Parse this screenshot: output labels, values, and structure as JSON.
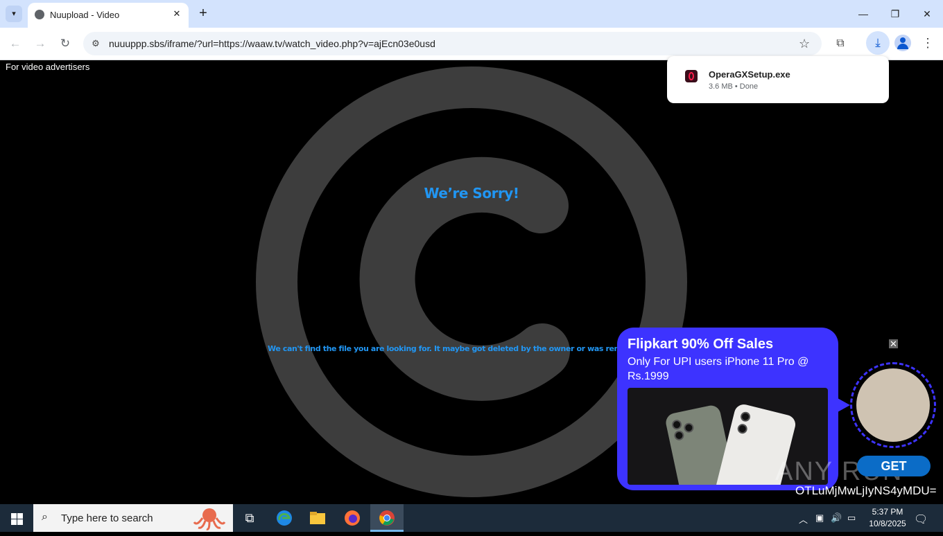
{
  "browser": {
    "tab_title": "Nuupload - Video",
    "url": "nuuuppp.sbs/iframe/?url=https://waaw.tv/watch_video.php?v=ajEcn03e0usd"
  },
  "page": {
    "advertisers_link": "For video advertisers",
    "sorry_heading": "We’re Sorry!",
    "not_found_message": "We can't find the file you are looking for. It maybe got deleted by the owner or was removed due a co"
  },
  "download_popup": {
    "file_name": "OperaGXSetup.exe",
    "status": "3.6 MB • Done"
  },
  "ad": {
    "title": "Flipkart 90% Off Sales",
    "subtitle": "Only For UPI users iPhone 11 Pro @ Rs.1999",
    "cta": "GET"
  },
  "watermark": {
    "brand": "ANY RUN",
    "code": "OTLuMjMwLjIyNS4yMDU="
  },
  "taskbar": {
    "search_placeholder": "Type here to search",
    "time": "5:37 PM",
    "date": "10/8/2025"
  },
  "colors": {
    "accent_blue": "#2196f3",
    "ad_background": "#3d33ff",
    "watermark_gray": "#3d3d3d"
  }
}
